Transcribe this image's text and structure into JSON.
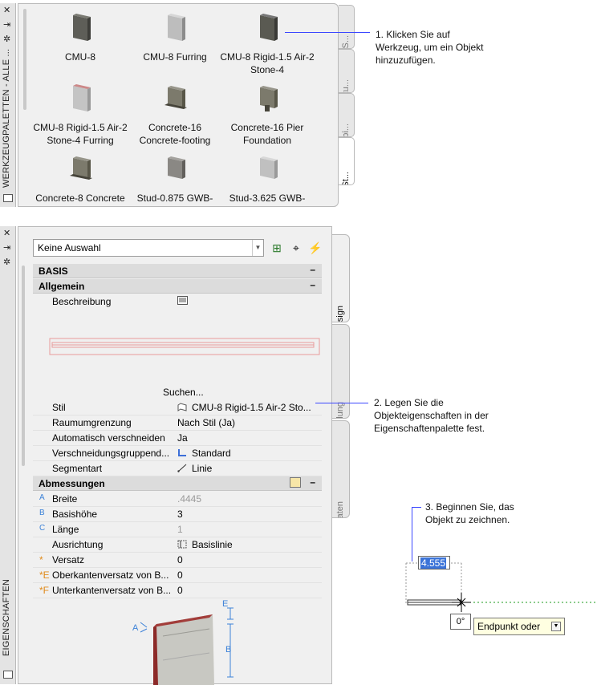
{
  "tool_palette": {
    "title": "WERKZEUGPALETTEN - ALLE ...",
    "tools": [
      {
        "label": "CMU-8",
        "icon": "cmu-8-wall-icon"
      },
      {
        "label": "CMU-8 Furring",
        "icon": "cmu-8-furring-wall-icon"
      },
      {
        "label": "CMU-8 Rigid-1.5 Air-2 Stone-4",
        "icon": "cmu-8-rigid-stone-wall-icon"
      },
      {
        "label": "CMU-8 Rigid-1.5 Air-2 Stone-4 Furring",
        "icon": "cmu-8-rigid-stone-furring-wall-icon"
      },
      {
        "label": "Concrete-16 Concrete-footing",
        "icon": "concrete-16-footing-wall-icon"
      },
      {
        "label": "Concrete-16 Pier Foundation",
        "icon": "concrete-16-pier-wall-icon"
      },
      {
        "label": "Concrete-8 Concrete",
        "icon": "concrete-8-wall-icon"
      },
      {
        "label": "Stud-0.875 GWB-",
        "icon": "stud-0875-wall-icon"
      },
      {
        "label": "Stud-3.625 GWB-",
        "icon": "stud-3625-wall-icon"
      }
    ],
    "tabs": [
      "Door S...",
      "Furnitu...",
      "Plumbi...",
      "Wall St..."
    ]
  },
  "properties_palette": {
    "title": "EIGENSCHAFTEN",
    "selection": "Keine Auswahl",
    "tabs": [
      "Design",
      "Darstellung",
      "Erweiterte Daten"
    ],
    "sections": {
      "basis": "BASIS",
      "allgemein": "Allgemein",
      "abmessungen": "Abmessungen"
    },
    "beschreibung_label": "Beschreibung",
    "suchen_label": "Suchen...",
    "general_rows": [
      {
        "label": "Stil",
        "value": "CMU-8 Rigid-1.5 Air-2 Sto..."
      },
      {
        "label": "Raumumgrenzung",
        "value": "Nach Stil (Ja)"
      },
      {
        "label": "Automatisch verschneiden",
        "value": "Ja"
      },
      {
        "label": "Verschneidungsgruppend...",
        "value": "Standard"
      },
      {
        "label": "Segmentart",
        "value": "Linie"
      }
    ],
    "dimension_rows": [
      {
        "key": "A",
        "label": "Breite",
        "value": ".4445"
      },
      {
        "key": "B",
        "label": "Basishöhe",
        "value": "3"
      },
      {
        "key": "C",
        "label": "Länge",
        "value": "1"
      },
      {
        "key": "",
        "label": "Ausrichtung",
        "value": "Basislinie"
      },
      {
        "key": "*",
        "label": "Versatz",
        "value": "0"
      },
      {
        "key": "*E",
        "label": "Oberkantenversatz von B...",
        "value": "0"
      },
      {
        "key": "*F",
        "label": "Unterkantenversatz von B...",
        "value": "0"
      }
    ],
    "diagram_labels": {
      "a": "A",
      "b": "B",
      "e": "E"
    }
  },
  "callouts": {
    "step1": "1. Klicken Sie auf Werkzeug, um ein Objekt hinzuzufügen.",
    "step2": "2. Legen Sie die Objekteigenschaften in der Eigenschaftenpalette fest.",
    "step3": "3. Beginnen Sie, das Objekt zu zeichnen."
  },
  "drawing": {
    "dynamic_input": "4.555",
    "angle": "0°",
    "prompt": "Endpunkt oder"
  },
  "colors": {
    "callout_line": "#3c48ff",
    "selection": "#3b73d8",
    "tooltip_bg": "#ffffe1",
    "track_line": "#1a9a1a"
  }
}
